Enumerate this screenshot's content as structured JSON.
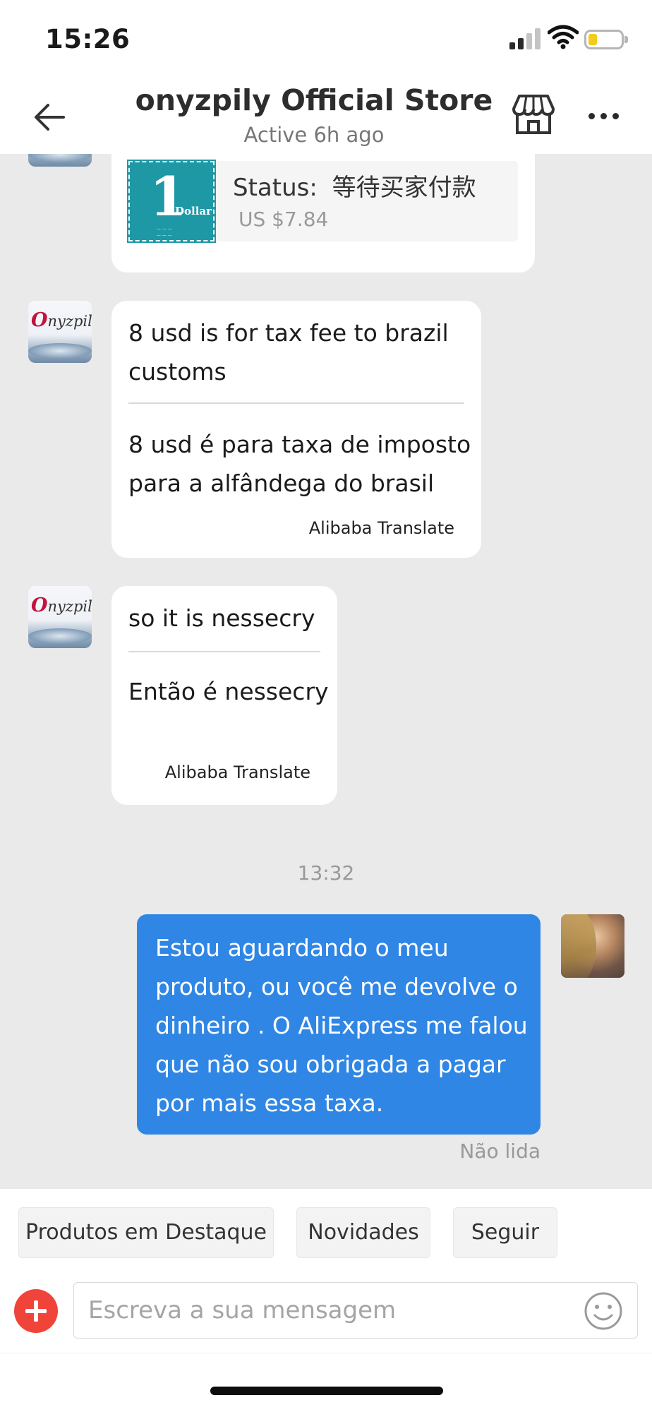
{
  "status_bar": {
    "time": "15:26"
  },
  "header": {
    "title": "onyzpily Official Store",
    "subtitle": "Active 6h ago"
  },
  "messages": [
    {
      "type": "product_card",
      "status_label": "Status:",
      "status_value": "等待买家付款",
      "price": "US $7.84",
      "product_image_text": "1",
      "product_image_caption": "Dollar"
    },
    {
      "type": "incoming",
      "original": "8 usd is for tax fee to brazil customs",
      "translation": "8 usd é para taxa de imposto para a alfândega do brasil",
      "translator": "Alibaba Translate"
    },
    {
      "type": "incoming",
      "original": "so it is nessecry",
      "translation": "Então é nessecry",
      "translator": "Alibaba Translate"
    }
  ],
  "time_separator": "13:32",
  "outgoing": {
    "text": "Estou aguardando o meu produto, ou você me devolve o dinheiro . O AliExpress me falou que não sou obrigada a pagar por mais essa taxa.",
    "status": "Não lida"
  },
  "avatar_logo": "nyzpily",
  "avatar_logo_initial": "O",
  "quick_replies": [
    "Produtos em Destaque",
    "Novidades",
    "Seguir"
  ],
  "composer": {
    "placeholder": "Escreva a sua mensagem"
  },
  "colors": {
    "outgoing_bubble": "#2f86e5",
    "add_button": "#f0443a",
    "chat_bg": "#eaeaea"
  },
  "icons": [
    "back-arrow-icon",
    "store-icon",
    "more-icon",
    "plus-icon",
    "emoji-icon",
    "signal-icon",
    "wifi-icon",
    "battery-icon"
  ]
}
